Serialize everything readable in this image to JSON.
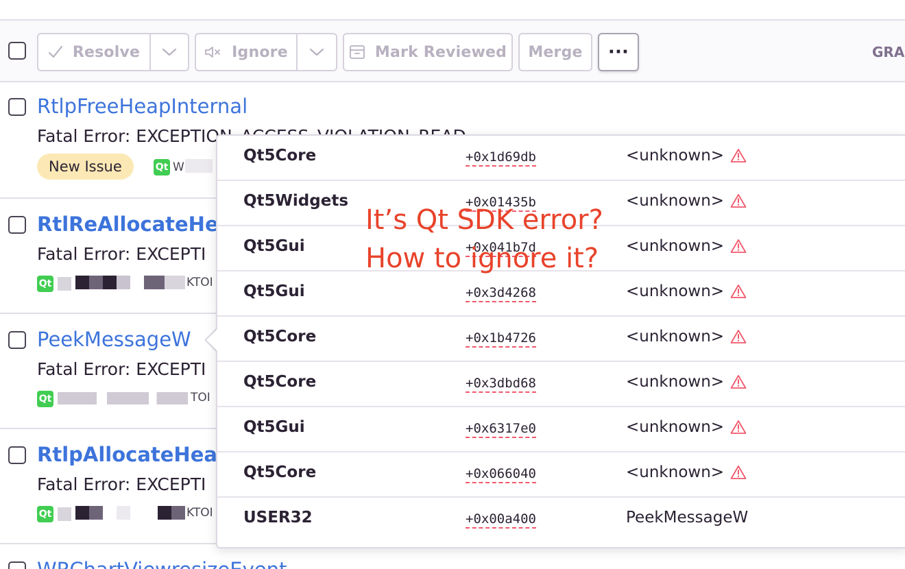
{
  "toolbar": {
    "resolve_label": "Resolve",
    "ignore_label": "Ignore",
    "mark_reviewed_label": "Mark Reviewed",
    "merge_label": "Merge",
    "more_label": "···",
    "graph_label": "GRA"
  },
  "issues": [
    {
      "title": "RtlpFreeHeapInternal",
      "subtitle": "Fatal Error: EXCEPTION_ACCESS_VIOLATION_READ",
      "badge": "New Issue",
      "meta": "W"
    },
    {
      "title": "RtlReAllocateHea",
      "subtitle": "Fatal Error: EXCEPTI",
      "meta": "KTOI"
    },
    {
      "title": "PeekMessageW",
      "subtitle": "Fatal Error: EXCEPTI",
      "meta": "TOI"
    },
    {
      "title": "RtlpAllocateHeap",
      "subtitle": "Fatal Error: EXCEPTI",
      "meta": "KTOI"
    },
    {
      "title": "WRChartViewresizeEvent"
    }
  ],
  "frames": [
    {
      "package": "Qt5Core",
      "address": "+0x1d69db",
      "function": "<unknown>",
      "warning": true
    },
    {
      "package": "Qt5Widgets",
      "address": "+0x01435b",
      "function": "<unknown>",
      "warning": true
    },
    {
      "package": "Qt5Gui",
      "address": "+0x041b7d",
      "function": "<unknown>",
      "warning": true
    },
    {
      "package": "Qt5Gui",
      "address": "+0x3d4268",
      "function": "<unknown>",
      "warning": true
    },
    {
      "package": "Qt5Core",
      "address": "+0x1b4726",
      "function": "<unknown>",
      "warning": true
    },
    {
      "package": "Qt5Core",
      "address": "+0x3dbd68",
      "function": "<unknown>",
      "warning": true
    },
    {
      "package": "Qt5Gui",
      "address": "+0x6317e0",
      "function": "<unknown>",
      "warning": true
    },
    {
      "package": "Qt5Core",
      "address": "+0x066040",
      "function": "<unknown>",
      "warning": true
    },
    {
      "package": "USER32",
      "address": "+0x00a400",
      "function": "PeekMessageW",
      "warning": false
    }
  ],
  "annotation": {
    "line1": "It’s Qt SDK error?",
    "line2": "How to ignore it?"
  },
  "icons": {
    "qt": "Qt",
    "resolve": "checkmark-icon",
    "ignore": "mute-icon",
    "mark_reviewed": "inbox-icon",
    "warning": "warning-triangle-icon",
    "dropdown": "chevron-down-icon"
  },
  "colors": {
    "link": "#3d74db",
    "badge_bg": "#fbe8b4",
    "warning": "#f0586c",
    "annotation": "#e8432b",
    "qt_green": "#41cd52"
  }
}
